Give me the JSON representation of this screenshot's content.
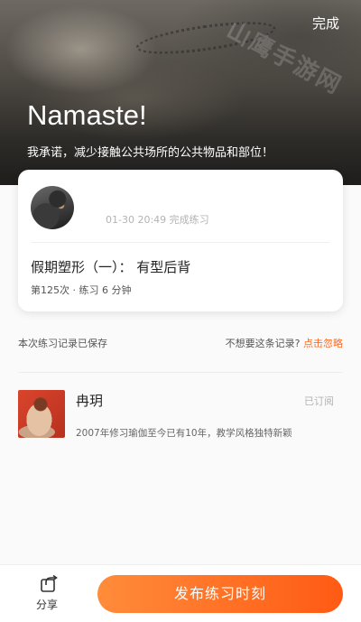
{
  "header": {
    "done_label": "完成",
    "title": "Namaste!",
    "subtitle": "我承诺，减少接触公共场所的公共物品和部位！",
    "watermark": "山鹰手游网"
  },
  "practice_card": {
    "time": "01-30 20:49 完成练习",
    "course_title": "假期塑形（一）： 有型后背",
    "meta": "第125次 · 练习 6 分钟"
  },
  "record": {
    "saved_text": "本次练习记录已保存",
    "ignore_prompt": "不想要这条记录?",
    "ignore_link": "点击忽略"
  },
  "teacher": {
    "name": "冉玥",
    "status": "已订阅",
    "description": "2007年修习瑜伽至今已有10年，教学风格独特新颖"
  },
  "bottom_bar": {
    "share_label": "分享",
    "share_icon": "share-icon",
    "publish_label": "发布练习时刻"
  },
  "colors": {
    "accent": "#ff6a21",
    "button_gradient_start": "#ff8c3a",
    "button_gradient_end": "#ff5a14"
  }
}
